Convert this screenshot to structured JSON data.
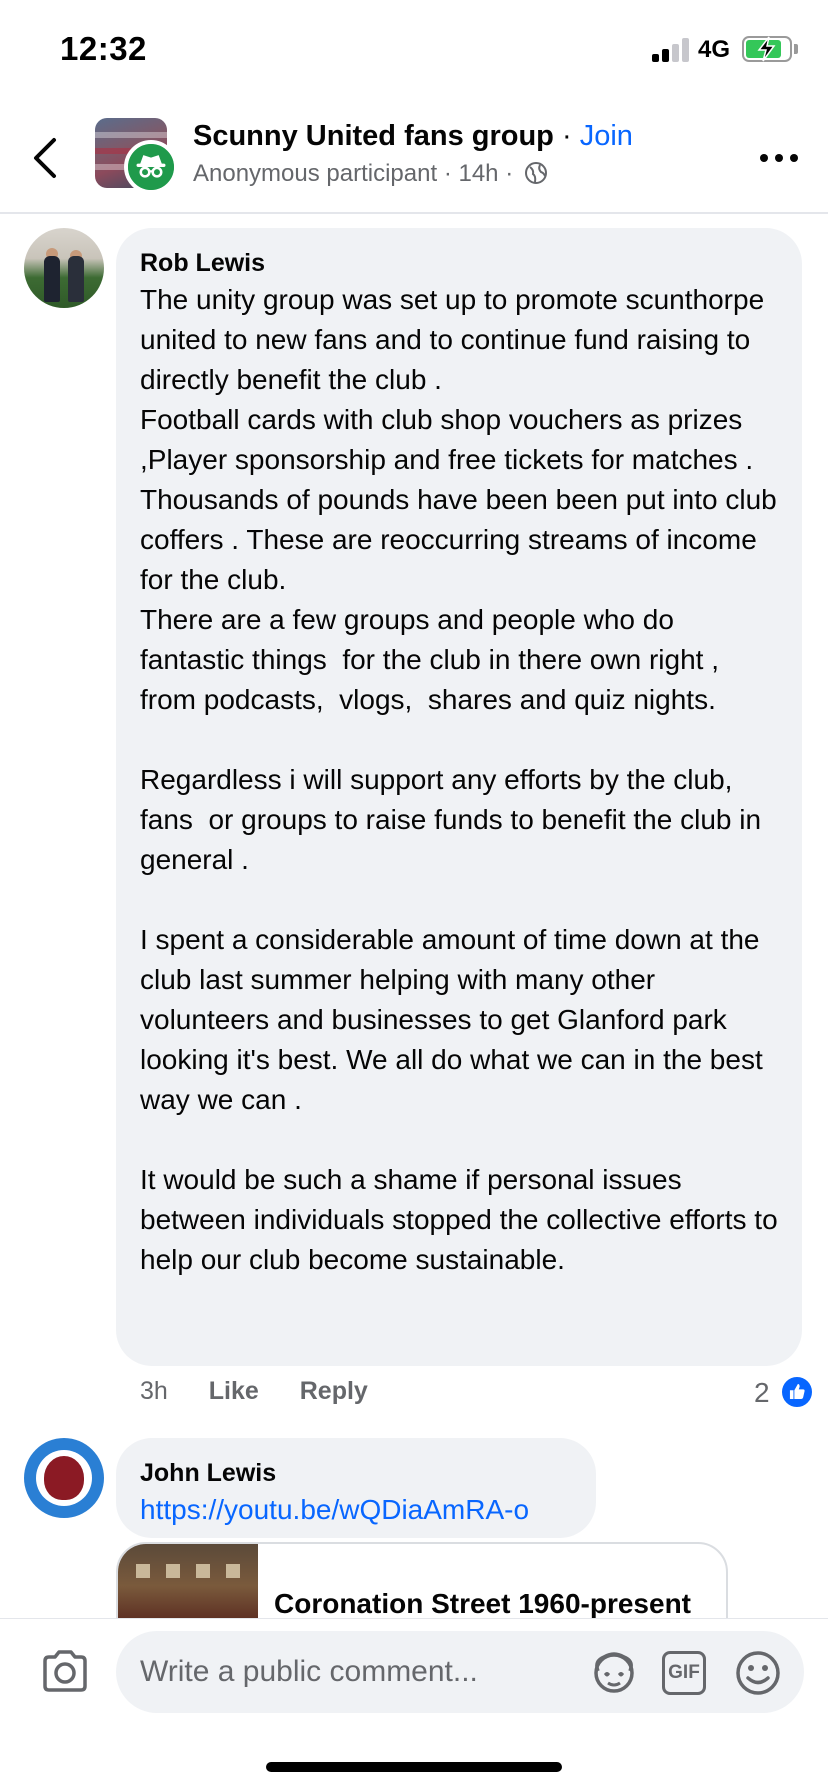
{
  "status_bar": {
    "time": "12:32",
    "network": "4G",
    "battery_level": 0.85,
    "battery_color": "#34c759"
  },
  "header": {
    "group_name": "Scunny United fans group",
    "separator": "·",
    "join_label": "Join",
    "participant_label": "Anonymous participant",
    "time_ago": "14h",
    "back_icon": "chevron-left-icon",
    "privacy_icon": "globe-icon",
    "more_icon": "more-horizontal-icon"
  },
  "comments": [
    {
      "author": "Rob Lewis",
      "text": "The unity group was set up to promote scunthorpe united to new fans and to continue fund raising to directly benefit the club .\nFootball cards with club shop vouchers as prizes ,Player sponsorship and free tickets for matches .\nThousands of pounds have been been put into club coffers . These are reoccurring streams of income for the club.\nThere are a few groups and people who do fantastic things  for the club in there own right , from podcasts,  vlogs,  shares and quiz nights.\n\nRegardless i will support any efforts by the club, fans  or groups to raise funds to benefit the club in general .\n\nI spent a considerable amount of time down at the club last summer helping with many other volunteers and businesses to get Glanford park looking it's best. We all do what we can in the best way we can .\n\nIt would be such a shame if personal issues between individuals stopped the collective efforts to help our club become sustainable.",
      "time": "3h",
      "like_label": "Like",
      "reply_label": "Reply",
      "reaction_count": "2",
      "reaction_icon": "thumbs-up-icon"
    },
    {
      "author": "John Lewis",
      "link": "https://youtu.be/wQDiaAmRA-o",
      "link_preview_title": "Coronation Street 1960-present"
    }
  ],
  "composer": {
    "placeholder": "Write a public comment...",
    "camera_icon": "camera-icon",
    "avatar_sticker_icon": "avatar-sticker-icon",
    "gif_label": "GIF",
    "emoji_icon": "emoji-icon"
  },
  "colors": {
    "link_blue": "#0866ff",
    "bubble_bg": "#f0f2f5",
    "secondary_text": "#65676b"
  }
}
